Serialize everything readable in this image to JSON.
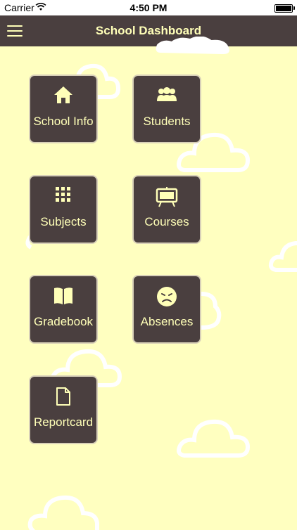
{
  "status_bar": {
    "carrier": "Carrier",
    "time": "4:50 PM"
  },
  "nav": {
    "title": "School Dashboard",
    "menu_icon": "hamburger-menu-icon"
  },
  "tiles": [
    {
      "label": "School Info",
      "icon": "house-icon"
    },
    {
      "label": "Students",
      "icon": "people-group-icon"
    },
    {
      "label": "Subjects",
      "icon": "grid-icon"
    },
    {
      "label": "Courses",
      "icon": "easel-board-icon"
    },
    {
      "label": "Gradebook",
      "icon": "open-book-icon"
    },
    {
      "label": "Absences",
      "icon": "sad-face-icon"
    },
    {
      "label": "Reportcard",
      "icon": "document-icon"
    }
  ],
  "colors": {
    "background": "#ffffc0",
    "tile": "#4a3f3f",
    "accent_text": "#ffffb8",
    "nav": "#4a3f3f"
  }
}
